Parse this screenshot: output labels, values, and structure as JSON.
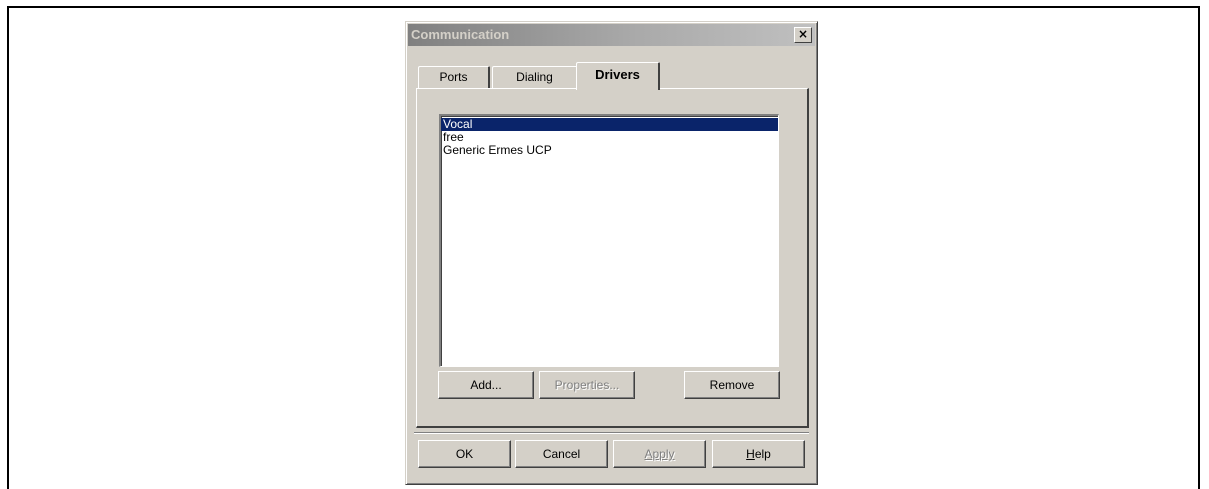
{
  "dialog": {
    "title": "Communication",
    "close_glyph": "×",
    "close_icon": "close-icon"
  },
  "tabs": [
    {
      "label": "Ports",
      "active": false
    },
    {
      "label": "Dialing",
      "active": false
    },
    {
      "label": "Drivers",
      "active": true
    }
  ],
  "drivers": {
    "items": [
      "Vocal",
      "free",
      "Generic Ermes UCP"
    ],
    "selected_index": 0,
    "buttons": {
      "add": "Add...",
      "properties": "Properties...",
      "remove": "Remove"
    }
  },
  "footer": {
    "ok": "OK",
    "cancel": "Cancel",
    "apply": "Apply",
    "help_accel": "H",
    "help_rest": "elp"
  },
  "colors": {
    "selection": "#0a246a",
    "face": "#d4d0c8"
  }
}
